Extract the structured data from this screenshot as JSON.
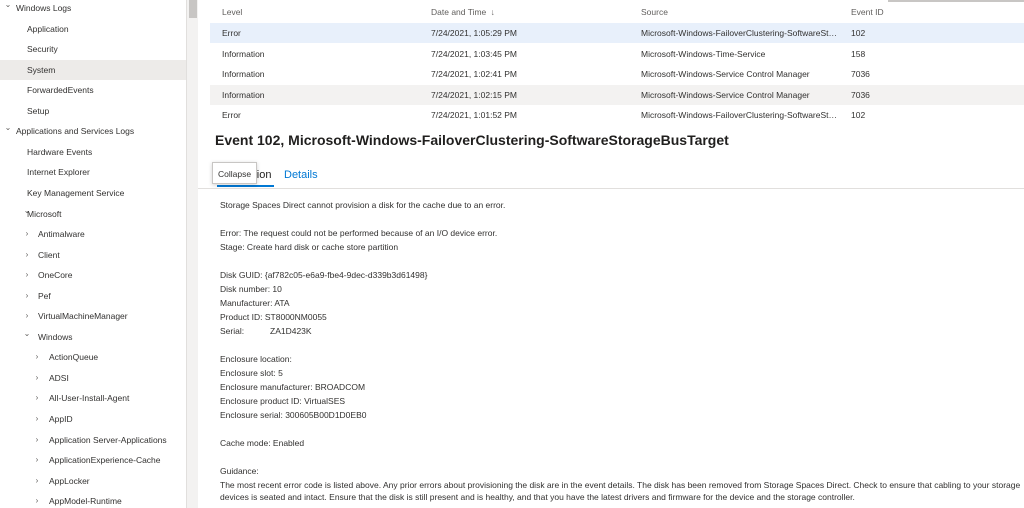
{
  "tree": {
    "items": [
      {
        "label": "Windows Logs",
        "chevron": "expanded",
        "depth": 0
      },
      {
        "label": "Application",
        "chevron": "",
        "depth": 1
      },
      {
        "label": "Security",
        "chevron": "",
        "depth": 1
      },
      {
        "label": "System",
        "chevron": "",
        "depth": 1,
        "selected": true
      },
      {
        "label": "ForwardedEvents",
        "chevron": "",
        "depth": 1
      },
      {
        "label": "Setup",
        "chevron": "",
        "depth": 1
      },
      {
        "label": "Applications and Services Logs",
        "chevron": "expanded",
        "depth": 0
      },
      {
        "label": "Hardware Events",
        "chevron": "",
        "depth": 1
      },
      {
        "label": "Internet Explorer",
        "chevron": "",
        "depth": 1
      },
      {
        "label": "Key Management Service",
        "chevron": "",
        "depth": 1
      },
      {
        "label": "Microsoft",
        "chevron": "expanded",
        "depth": 1
      },
      {
        "label": "Antimalware",
        "chevron": "collapsed",
        "depth": 2
      },
      {
        "label": "Client",
        "chevron": "collapsed",
        "depth": 2
      },
      {
        "label": "OneCore",
        "chevron": "collapsed",
        "depth": 2
      },
      {
        "label": "Pef",
        "chevron": "collapsed",
        "depth": 2
      },
      {
        "label": "VirtualMachineManager",
        "chevron": "collapsed",
        "depth": 2
      },
      {
        "label": "Windows",
        "chevron": "expanded",
        "depth": 2
      },
      {
        "label": "ActionQueue",
        "chevron": "collapsed",
        "depth": 3
      },
      {
        "label": "ADSI",
        "chevron": "collapsed",
        "depth": 3
      },
      {
        "label": "All-User-Install-Agent",
        "chevron": "collapsed",
        "depth": 3
      },
      {
        "label": "AppID",
        "chevron": "collapsed",
        "depth": 3
      },
      {
        "label": "Application Server-Applications",
        "chevron": "collapsed",
        "depth": 3
      },
      {
        "label": "ApplicationExperience-Cache",
        "chevron": "collapsed",
        "depth": 3
      },
      {
        "label": "AppLocker",
        "chevron": "collapsed",
        "depth": 3
      },
      {
        "label": "AppModel-Runtime",
        "chevron": "collapsed",
        "depth": 3
      }
    ]
  },
  "table": {
    "headers": {
      "level": "Level",
      "datetime": "Date and Time",
      "sort_indicator": "↓",
      "source": "Source",
      "event_id": "Event ID"
    },
    "rows": [
      {
        "level": "Error",
        "datetime": "7/24/2021, 1:05:29 PM",
        "source": "Microsoft-Windows-FailoverClustering-SoftwareStora...",
        "event_id": "102",
        "state": "selected"
      },
      {
        "level": "Information",
        "datetime": "7/24/2021, 1:03:45 PM",
        "source": "Microsoft-Windows-Time-Service",
        "event_id": "158",
        "state": ""
      },
      {
        "level": "Information",
        "datetime": "7/24/2021, 1:02:41 PM",
        "source": "Microsoft-Windows-Service Control Manager",
        "event_id": "7036",
        "state": ""
      },
      {
        "level": "Information",
        "datetime": "7/24/2021, 1:02:15 PM",
        "source": "Microsoft-Windows-Service Control Manager",
        "event_id": "7036",
        "state": "alt"
      },
      {
        "level": "Error",
        "datetime": "7/24/2021, 1:01:52 PM",
        "source": "Microsoft-Windows-FailoverClustering-SoftwareStora...",
        "event_id": "102",
        "state": ""
      }
    ]
  },
  "detail": {
    "title": "Event 102, Microsoft-Windows-FailoverClustering-SoftwareStorageBusTarget",
    "tabs": {
      "general": "General",
      "general_visible": "tion",
      "details": "Details"
    },
    "tooltip": "Collapse",
    "lines": [
      "Storage Spaces Direct cannot provision a disk for the cache due to an error.",
      "Error: The request could not be performed because of an I/O device error.",
      "Stage: Create hard disk or cache store partition",
      "Disk GUID: {af782c05-e6a9-fbe4-9dec-d339b3d61498}",
      "Disk number: 10",
      "Manufacturer: ATA",
      "Product ID: ST8000NM0055",
      "Enclosure location:",
      "Enclosure slot: 5",
      "Enclosure manufacturer: BROADCOM",
      "Enclosure product ID: VirtualSES",
      "Enclosure serial: 300605B00D1D0EB0",
      "Cache mode: Enabled",
      "Guidance:",
      "The most recent error code is listed above. Any prior errors about provisioning the disk are in the event details. The disk has been removed from Storage Spaces Direct. Check to ensure that cabling to your storage devices is seated and intact. Ensure that the disk is still present and is healthy, and that you have the latest drivers and firmware for the device and the storage controller."
    ],
    "serial_label": "Serial:",
    "serial_value": "ZA1D423K"
  },
  "colors": {
    "accent": "#0078d4",
    "selected_row": "#e8f0fb",
    "selected_tree": "#edebe9"
  }
}
